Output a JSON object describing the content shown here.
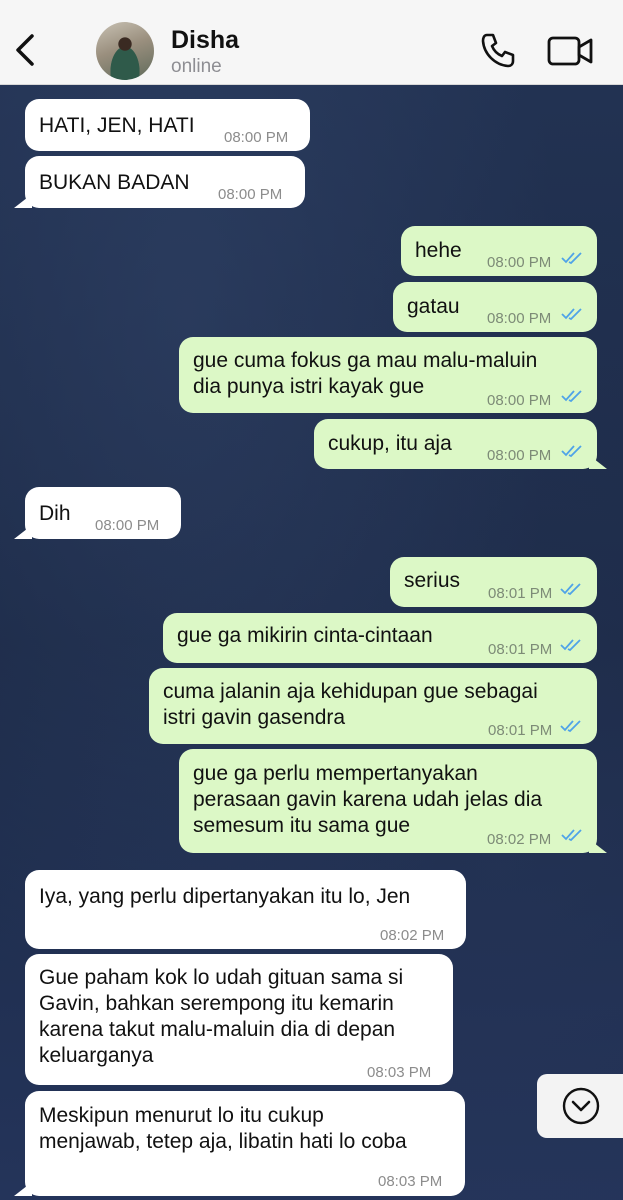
{
  "header": {
    "contact_name": "Disha",
    "status": "online",
    "icons": {
      "back": "chevron-left-icon",
      "call": "phone-icon",
      "video": "video-camera-icon"
    }
  },
  "colors": {
    "incoming": "#ffffff",
    "outgoing": "#dcf8c6",
    "ticks": "#4fa3e8",
    "background": "#1f2d4a"
  },
  "messages": [
    {
      "dir": "in",
      "text": "HATI, JEN, HATI",
      "time": "08:00 PM"
    },
    {
      "dir": "in",
      "text": "BUKAN BADAN",
      "time": "08:00 PM"
    },
    {
      "dir": "out",
      "text": "hehe",
      "time": "08:00 PM",
      "status": "read"
    },
    {
      "dir": "out",
      "text": "gatau",
      "time": "08:00 PM",
      "status": "read"
    },
    {
      "dir": "out",
      "text": "gue cuma fokus ga mau malu-maluin\ndia punya istri kayak gue",
      "time": "08:00 PM",
      "status": "read"
    },
    {
      "dir": "out",
      "text": "cukup, itu aja",
      "time": "08:00 PM",
      "status": "read"
    },
    {
      "dir": "in",
      "text": "Dih",
      "time": "08:00 PM"
    },
    {
      "dir": "out",
      "text": "serius",
      "time": "08:01 PM",
      "status": "read"
    },
    {
      "dir": "out",
      "text": "gue ga mikirin cinta-cintaan",
      "time": "08:01 PM",
      "status": "read"
    },
    {
      "dir": "out",
      "text": "cuma jalanin aja kehidupan gue sebagai\nistri gavin gasendra",
      "time": "08:01 PM",
      "status": "read"
    },
    {
      "dir": "out",
      "text": "gue ga perlu mempertanyakan\nperasaan gavin karena udah jelas dia\nsemesum itu sama gue",
      "time": "08:02 PM",
      "status": "read"
    },
    {
      "dir": "in",
      "text": "Iya, yang perlu dipertanyakan itu lo, Jen",
      "time": "08:02 PM"
    },
    {
      "dir": "in",
      "text": "Gue paham kok lo udah gituan sama si\nGavin, bahkan serempong itu kemarin\nkarena takut malu-maluin dia di depan\nkeluarganya",
      "time": "08:03 PM"
    },
    {
      "dir": "in",
      "text": "Meskipun menurut lo itu cukup\nmenjawab, tetep aja, libatin hati lo coba",
      "time": "08:03 PM"
    }
  ],
  "scroll_button_icon": "chevron-down-circle-icon"
}
